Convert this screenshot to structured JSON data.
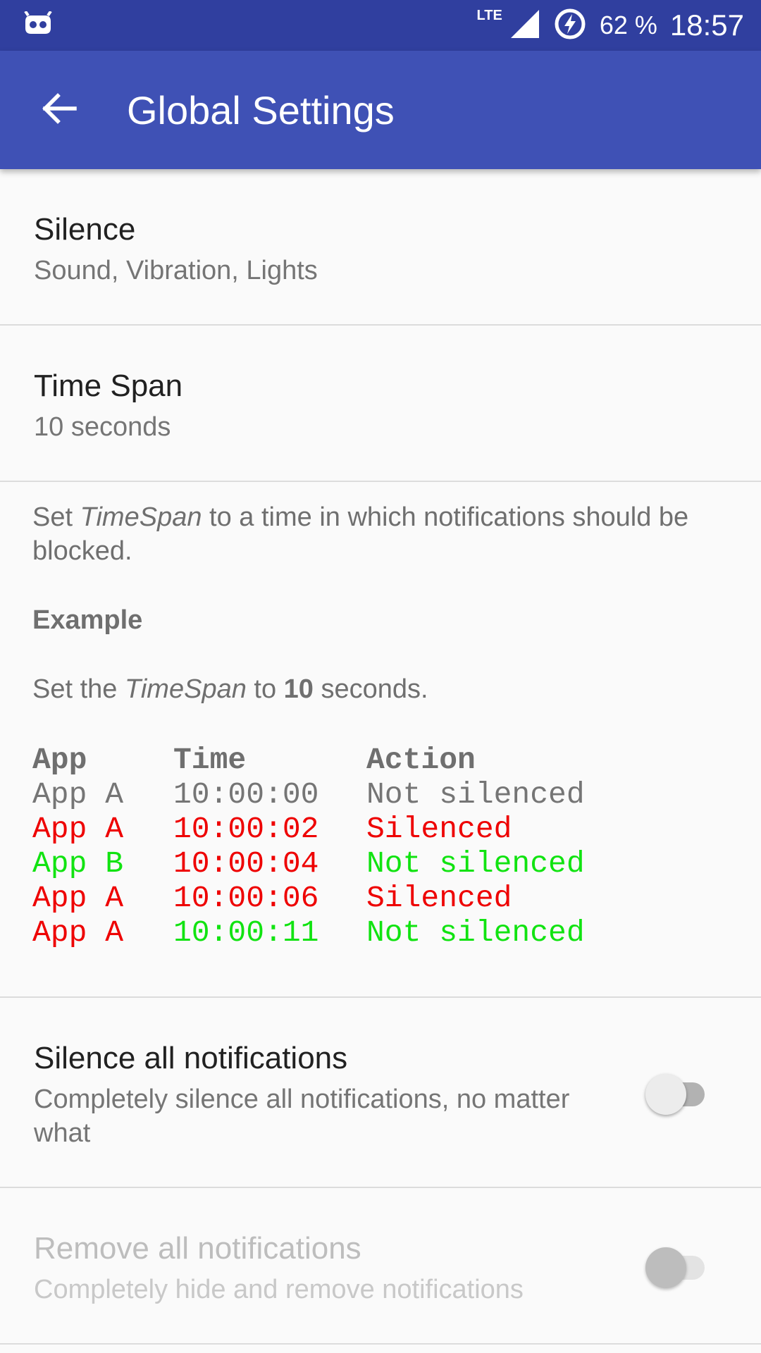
{
  "status_bar": {
    "network": "LTE",
    "battery": "62 %",
    "time": "18:57",
    "icons": [
      "cyanogen-icon",
      "signal-icon",
      "battery-charging-icon"
    ]
  },
  "app_bar": {
    "title": "Global Settings",
    "back_icon": "arrow-back-icon"
  },
  "prefs": {
    "silence": {
      "title": "Silence",
      "summary": "Sound, Vibration, Lights"
    },
    "time_span": {
      "title": "Time Span",
      "summary": "10 seconds"
    }
  },
  "info": {
    "intro_1": "Set ",
    "intro_em": "TimeSpan",
    "intro_2": " to a time in which notifications should be blocked.",
    "example_heading": "Example",
    "example_1": "Set the ",
    "example_em": "TimeSpan",
    "example_2": " to ",
    "example_strong": "10",
    "example_3": " seconds.",
    "table": {
      "headers": [
        "App",
        "Time",
        "Action"
      ],
      "rows": [
        [
          {
            "text": "App A",
            "color": "gray"
          },
          {
            "text": "10:00:00",
            "color": "gray"
          },
          {
            "text": "Not silenced",
            "color": "gray"
          }
        ],
        [
          {
            "text": "App A",
            "color": "red"
          },
          {
            "text": "10:00:02",
            "color": "red"
          },
          {
            "text": "Silenced",
            "color": "red"
          }
        ],
        [
          {
            "text": "App B",
            "color": "green"
          },
          {
            "text": "10:00:04",
            "color": "red"
          },
          {
            "text": "Not silenced",
            "color": "green"
          }
        ],
        [
          {
            "text": "App A",
            "color": "red"
          },
          {
            "text": "10:00:06",
            "color": "red"
          },
          {
            "text": "Silenced",
            "color": "red"
          }
        ],
        [
          {
            "text": "App A",
            "color": "red"
          },
          {
            "text": "10:00:11",
            "color": "green"
          },
          {
            "text": "Not silenced",
            "color": "green"
          }
        ]
      ]
    }
  },
  "toggles": {
    "silence_all": {
      "title": "Silence all notifications",
      "summary": "Completely silence all notifications, no matter what",
      "checked": false,
      "enabled": true
    },
    "remove_all": {
      "title": "Remove all notifications",
      "summary": "Completely hide and remove notifications",
      "checked": false,
      "enabled": false
    }
  },
  "colors": {
    "status_bar": "#303f9f",
    "app_bar": "#3f51b5",
    "red": "#ee0000",
    "green": "#11e311",
    "gray": "#757575"
  }
}
